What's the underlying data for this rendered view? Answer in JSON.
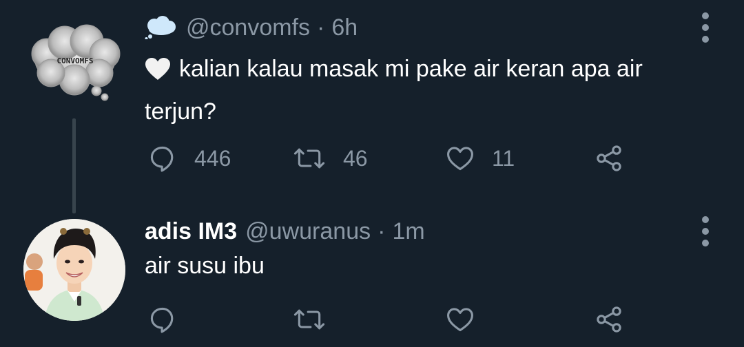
{
  "tweets": [
    {
      "avatar_label": "CONVOMFS",
      "emoji_prefix": "cloud-emoji",
      "handle": "@convomfs",
      "time": "6h",
      "text_emoji": "white-heart-emoji",
      "text": "kalian kalau masak mi pake air keran apa air terjun?",
      "actions": {
        "reply_count": "446",
        "retweet_count": "46",
        "like_count": "11"
      }
    },
    {
      "name": "adis IM3",
      "handle": "@uwuranus",
      "time": "1m",
      "text": "air susu ibu",
      "actions": {
        "reply_count": "",
        "retweet_count": "",
        "like_count": ""
      }
    }
  ],
  "separator": "·",
  "icons": {
    "reply": "reply-icon",
    "retweet": "retweet-icon",
    "like": "like-icon",
    "share": "share-icon",
    "more": "more-options-icon"
  },
  "colors": {
    "background": "#15202b",
    "primary_text": "#ffffff",
    "secondary_text": "#8b98a5",
    "thread_line": "#38444d"
  }
}
